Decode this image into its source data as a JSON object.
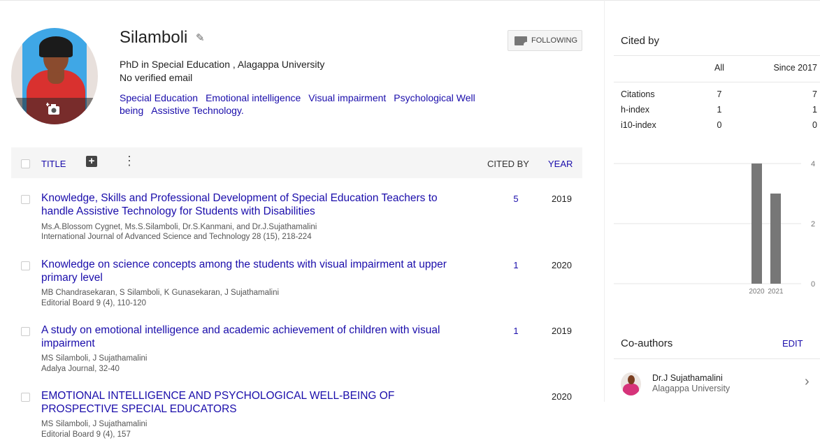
{
  "profile": {
    "name": "Silamboli",
    "affiliation": "PhD in Special Education , Alagappa University",
    "email": "No verified email",
    "interests": [
      "Special Education",
      "Emotional intelligence",
      "Visual impairment",
      "Psychological Well being",
      "Assistive Technology."
    ],
    "follow_label": "FOLLOWING"
  },
  "table": {
    "col_title": "TITLE",
    "col_cited": "CITED BY",
    "col_year": "YEAR",
    "rows": [
      {
        "title": "Knowledge, Skills and Professional Development of Special Education Teachers to handle Assistive Technology for Students with Disabilities",
        "authors": "Ms.A.Blossom Cygnet, Ms.S.Silamboli, Dr.S.Kanmani, and Dr.J.Sujathamalini",
        "venue": "International Journal of Advanced Science and Technology 28 (15), 218-224",
        "cited": "5",
        "year": "2019"
      },
      {
        "title": "Knowledge on science concepts among the students with visual impairment at upper primary level",
        "authors": "MB Chandrasekaran, S Silamboli, K Gunasekaran, J Sujathamalini",
        "venue": "Editorial Board 9 (4), 110-120",
        "cited": "1",
        "year": "2020"
      },
      {
        "title": "A study on emotional intelligence and academic achievement of children with visual impairment",
        "authors": "MS Silamboli, J Sujathamalini",
        "venue": "Adalya Journal, 32-40",
        "cited": "1",
        "year": "2019"
      },
      {
        "title": "EMOTIONAL INTELLIGENCE AND PSYCHOLOGICAL WELL-BEING OF PROSPECTIVE SPECIAL EDUCATORS",
        "authors": "MS Silamboli, J Sujathamalini",
        "venue": "Editorial Board 9 (4), 157",
        "cited": "",
        "year": "2020"
      }
    ]
  },
  "cited_by": {
    "heading": "Cited by",
    "col_all": "All",
    "col_since": "Since 2017",
    "metrics": [
      {
        "label": "Citations",
        "all": "7",
        "since": "7"
      },
      {
        "label": "h-index",
        "all": "1",
        "since": "1"
      },
      {
        "label": "i10-index",
        "all": "0",
        "since": "0"
      }
    ]
  },
  "chart_data": {
    "type": "bar",
    "categories": [
      "2020",
      "2021"
    ],
    "values": [
      4,
      3
    ],
    "ylim": [
      0,
      4
    ],
    "yticks": [
      "0",
      "2",
      "4"
    ],
    "grid": true,
    "color": "#777777"
  },
  "coauthors": {
    "heading": "Co-authors",
    "edit_label": "EDIT",
    "items": [
      {
        "name": "Dr.J Sujathamalini",
        "affiliation": "Alagappa University"
      }
    ]
  },
  "icons": {
    "pencil": "✎",
    "more": "⋮",
    "chevron": "›",
    "add": "+",
    "camera": "📷"
  }
}
